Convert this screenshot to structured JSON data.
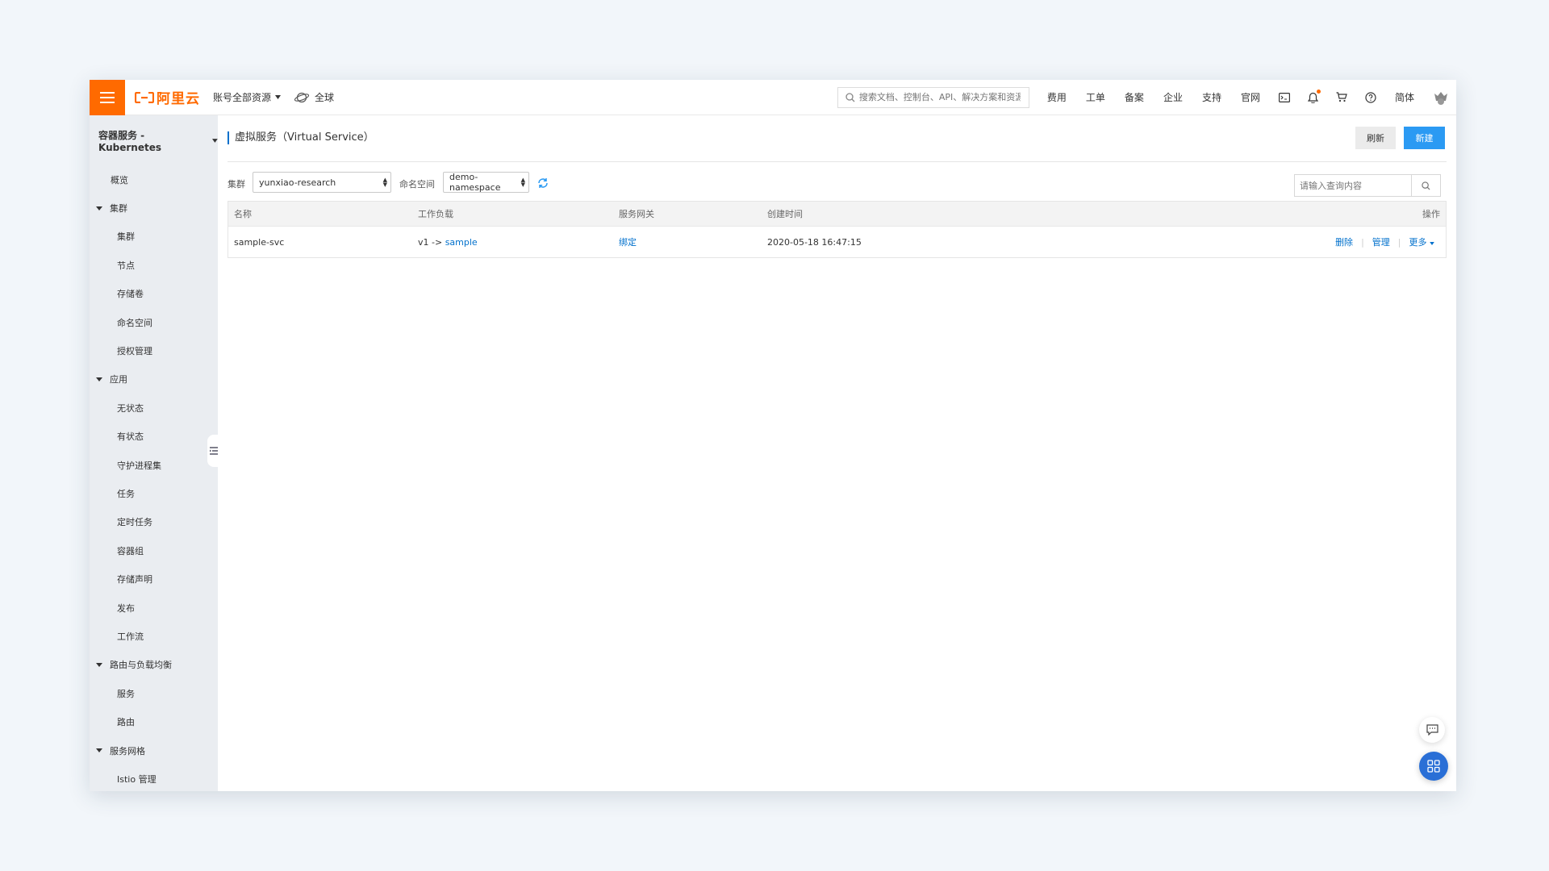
{
  "topbar": {
    "brand": "阿里云",
    "resources_label": "账号全部资源",
    "region_label": "全球",
    "search_placeholder": "搜索文档、控制台、API、解决方案和资源",
    "nav": [
      "费用",
      "工单",
      "备案",
      "企业",
      "支持",
      "官网"
    ],
    "language": "简体",
    "icons": [
      "terminal-icon",
      "bell-icon",
      "cart-icon",
      "help-icon"
    ],
    "accent_color": "#ff6a00"
  },
  "sidebar": {
    "title": "容器服务 - Kubernetes",
    "overview": "概览",
    "groups": [
      {
        "label": "集群",
        "items": [
          "集群",
          "节点",
          "存储卷",
          "命名空间",
          "授权管理"
        ]
      },
      {
        "label": "应用",
        "items": [
          "无状态",
          "有状态",
          "守护进程集",
          "任务",
          "定时任务",
          "容器组",
          "存储声明",
          "发布",
          "工作流"
        ]
      },
      {
        "label": "路由与负载均衡",
        "items": [
          "服务",
          "路由"
        ]
      },
      {
        "label": "服务网格",
        "items": [
          "Istio 管理"
        ]
      }
    ]
  },
  "page": {
    "title": "虚拟服务（Virtual Service）",
    "refresh_label": "刷新",
    "new_label": "新建"
  },
  "filters": {
    "cluster_label": "集群",
    "cluster_value": "yunxiao-research",
    "namespace_label": "命名空间",
    "namespace_value": "demo-namespace",
    "search_placeholder": "请输入查询内容"
  },
  "table": {
    "headers": {
      "name": "名称",
      "workload": "工作负载",
      "gateway": "服务网关",
      "created": "创建时间",
      "actions": "操作"
    },
    "rows": [
      {
        "name": "sample-svc",
        "workload_prefix": "v1 ->",
        "workload_link": "sample",
        "gateway": "绑定",
        "created": "2020-05-18 16:47:15",
        "actions": [
          "删除",
          "管理",
          "更多"
        ]
      }
    ],
    "link_color": "#0070cc"
  }
}
